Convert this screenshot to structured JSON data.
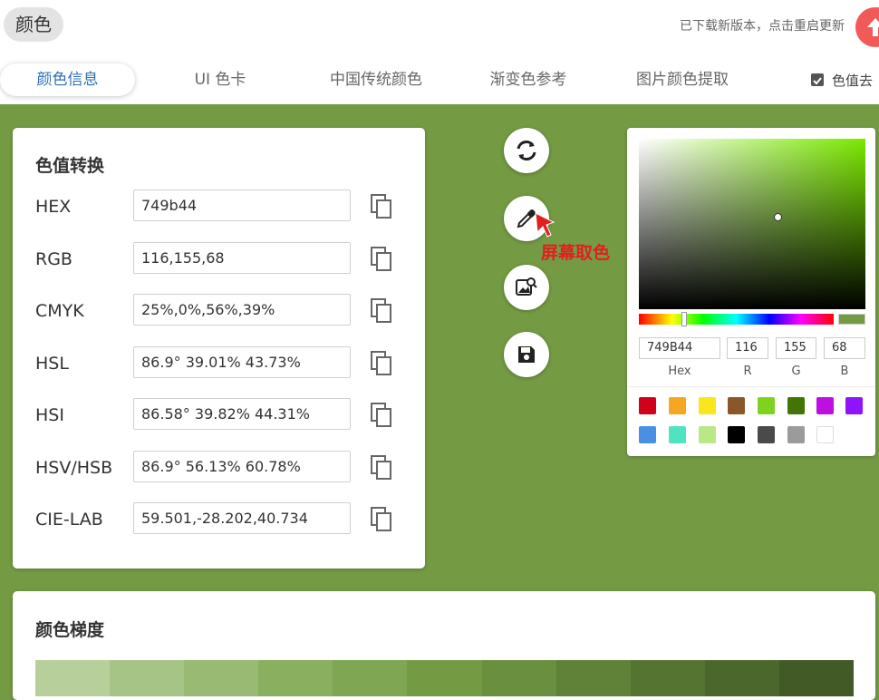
{
  "header": {
    "app_title": "颜色",
    "update_notice": "已下载新版本，点击重启更新"
  },
  "tabs": [
    {
      "label": "颜色信息",
      "active": true
    },
    {
      "label": "UI 色卡"
    },
    {
      "label": "中国传统颜色"
    },
    {
      "label": "渐变色参考"
    },
    {
      "label": "图片颜色提取"
    }
  ],
  "tab_option": {
    "label": "色值去",
    "checked": true
  },
  "converter": {
    "title": "色值转换",
    "rows": [
      {
        "label": "HEX",
        "value": "749b44"
      },
      {
        "label": "RGB",
        "value": "116,155,68"
      },
      {
        "label": "CMYK",
        "value": "25%,0%,56%,39%"
      },
      {
        "label": "HSL",
        "value": "86.9° 39.01% 43.73%"
      },
      {
        "label": "HSI",
        "value": "86.58° 39.82% 44.31%"
      },
      {
        "label": "HSV/HSB",
        "value": "86.9° 56.13% 60.78%"
      },
      {
        "label": "CIE-LAB",
        "value": "59.501,-28.202,40.734"
      }
    ]
  },
  "tools": {
    "tooltip": "屏幕取色",
    "icons": [
      "refresh-icon",
      "eyedropper-icon",
      "image-search-icon",
      "save-icon"
    ]
  },
  "picker": {
    "hex": "749B44",
    "r": "116",
    "g": "155",
    "b": "68",
    "labels": {
      "hex": "Hex",
      "r": "R",
      "g": "G",
      "b": "B"
    },
    "presets": [
      "#d0021b",
      "#f5a623",
      "#f8e71c",
      "#8b572a",
      "#7ed321",
      "#417505",
      "#bd10e0",
      "#9013fe",
      "#4a90e2",
      "#50e3c2",
      "#b8e986",
      "#000000",
      "#4a4a4a",
      "#9b9b9b",
      "#ffffff"
    ]
  },
  "gradient": {
    "title": "颜色梯度",
    "steps": [
      "#b7cf9b",
      "#a6c486",
      "#98ba72",
      "#8aaf5f",
      "#7ea653",
      "#749b44",
      "#6a8f3e",
      "#5f8238",
      "#557432",
      "#4b672c",
      "#415a26"
    ]
  },
  "colors": {
    "background": "#749b44",
    "active_tab": "#2f6fb8",
    "tooltip": "#e02020"
  }
}
